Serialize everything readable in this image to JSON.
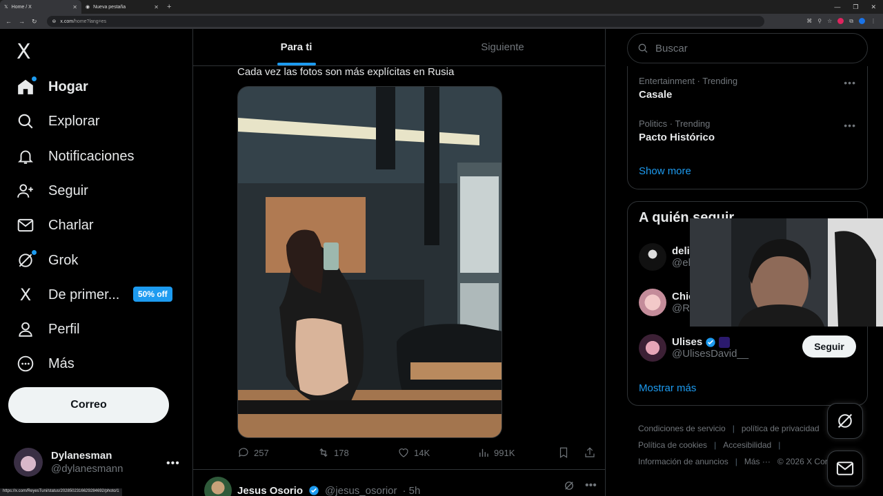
{
  "browser": {
    "tabs": [
      {
        "title": "Home / X",
        "active": true
      },
      {
        "title": "Nueva pestaña",
        "active": false
      }
    ],
    "url_host": "x.com",
    "url_path": "/home?lang=es"
  },
  "nav": {
    "logo": "X",
    "items": [
      {
        "label": "Hogar",
        "icon": "home-icon",
        "bold": true
      },
      {
        "label": "Explorar",
        "icon": "search-icon"
      },
      {
        "label": "Notificaciones",
        "icon": "bell-icon"
      },
      {
        "label": "Seguir",
        "icon": "follow-icon"
      },
      {
        "label": "Charlar",
        "icon": "mail-icon"
      },
      {
        "label": "Grok",
        "icon": "grok-icon"
      },
      {
        "label": "De primer...",
        "icon": "x-premium-icon"
      },
      {
        "label": "Perfil",
        "icon": "person-icon"
      },
      {
        "label": "Más",
        "icon": "more-circle-icon"
      }
    ],
    "premium_badge": "50% off",
    "post_button": "Correo",
    "profile_name": "Dylanesman",
    "profile_handle": "@dylanesmann"
  },
  "status_url": "https://x.com/ReyesTuni/status/2028502316629284692/photo/1",
  "timeline": {
    "tabs": [
      {
        "label": "Para ti",
        "active": true
      },
      {
        "label": "Siguiente",
        "active": false
      }
    ],
    "post": {
      "text": "Cada vez las fotos son más explícitas en Rusia",
      "replies": "257",
      "reposts": "178",
      "likes": "14K",
      "views": "991K"
    },
    "next_post": {
      "name": "Jesus Osorio",
      "handle": "@jesus_osorior",
      "time": "· 5h"
    }
  },
  "sidebar": {
    "search_placeholder": "Buscar",
    "trends": [
      {
        "category": "Entertainment · Trending",
        "name": "Casale"
      },
      {
        "category": "Politics · Trending",
        "name": "Pacto Histórico"
      }
    ],
    "trends_show_more": "Show more",
    "who_to_follow_title": "A quién seguir",
    "who_to_follow": [
      {
        "name": "deli",
        "handle": "@el"
      },
      {
        "name": "Chic",
        "handle": "@Re"
      },
      {
        "name": "Ulises",
        "handle": "@UlisesDavid__"
      }
    ],
    "follow_button": "Seguir",
    "follow_show_more": "Mostrar más",
    "footer": [
      "Condiciones de servicio",
      "política de privacidad",
      "Política de cookies",
      "Accesibilidad",
      "Información de anuncios",
      "Más ···",
      "© 2026 X Corp."
    ]
  },
  "colors": {
    "accent": "#1d9bf0",
    "bg": "#000000",
    "border": "#2f3336",
    "muted": "#71767b"
  }
}
